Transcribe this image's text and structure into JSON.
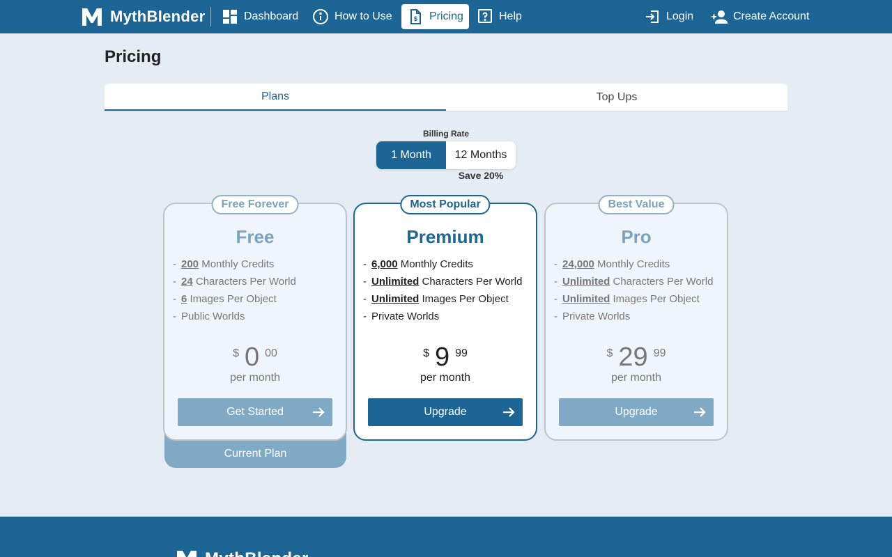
{
  "header": {
    "brand": "MythBlender",
    "nav": [
      {
        "label": "Dashboard",
        "icon": "dashboard-icon"
      },
      {
        "label": "How to Use",
        "icon": "info-icon"
      },
      {
        "label": "Pricing",
        "icon": "invoice-icon"
      },
      {
        "label": "Help",
        "icon": "help-icon"
      }
    ],
    "login_label": "Login",
    "create_account_label": "Create Account"
  },
  "page": {
    "title": "Pricing"
  },
  "tabs": [
    {
      "label": "Plans",
      "active": true
    },
    {
      "label": "Top Ups",
      "active": false
    }
  ],
  "billing": {
    "label": "Billing Rate",
    "options": [
      "1 Month",
      "12 Months"
    ],
    "selected": "1 Month",
    "save_note": "Save 20%"
  },
  "plans": [
    {
      "badge": "Free Forever",
      "name": "Free",
      "features": [
        {
          "highlight": "200",
          "text": " Monthly Credits"
        },
        {
          "highlight": "24",
          "text": " Characters Per World"
        },
        {
          "highlight": "6",
          "text": " Images Per Object"
        },
        {
          "highlight": "",
          "text": "Public Worlds"
        }
      ],
      "currency": "$",
      "price_int": "0",
      "price_cents": "00",
      "period": "per month",
      "cta": "Get Started",
      "current_label": "Current Plan"
    },
    {
      "badge": "Most Popular",
      "name": "Premium",
      "features": [
        {
          "highlight": "6,000",
          "text": " Monthly Credits"
        },
        {
          "highlight": "Unlimited",
          "text": " Characters Per World"
        },
        {
          "highlight": "Unlimited",
          "text": " Images Per Object"
        },
        {
          "highlight": "",
          "text": "Private Worlds"
        }
      ],
      "currency": "$",
      "price_int": "9",
      "price_cents": "99",
      "period": "per month",
      "cta": "Upgrade"
    },
    {
      "badge": "Best Value",
      "name": "Pro",
      "features": [
        {
          "highlight": "24,000",
          "text": " Monthly Credits"
        },
        {
          "highlight": "Unlimited",
          "text": " Characters Per World"
        },
        {
          "highlight": "Unlimited",
          "text": " Images Per Object"
        },
        {
          "highlight": "",
          "text": "Private Worlds"
        }
      ],
      "currency": "$",
      "price_int": "29",
      "price_cents": "99",
      "period": "per month",
      "cta": "Upgrade"
    }
  ],
  "footer": {
    "brand": "MythBlender"
  },
  "colors": {
    "primary": "#1c6594",
    "muted_blue": "#80a9c6",
    "background": "#e5ecf3"
  }
}
